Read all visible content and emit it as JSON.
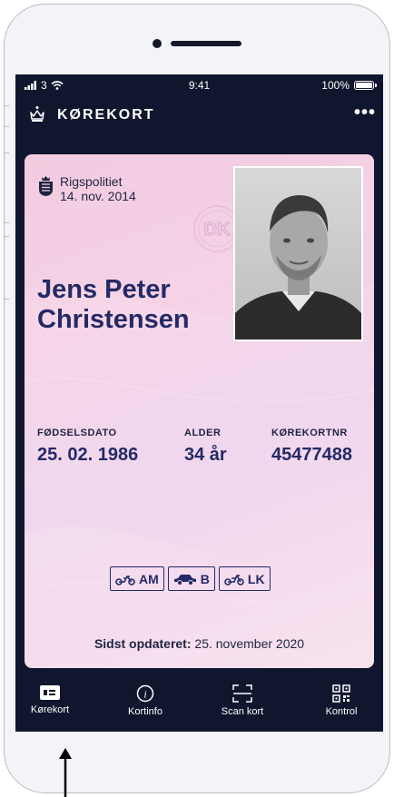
{
  "status_bar": {
    "carrier": "3",
    "time": "9:41",
    "battery": "100%"
  },
  "app_bar": {
    "title": "KØREKORT",
    "menu_glyph": "•••",
    "icons": {
      "logo": "crown-icon",
      "menu": "more-icon"
    }
  },
  "card": {
    "issuer": "Rigspolitiet",
    "issue_date": "14. nov. 2014",
    "holder_name": "Jens Peter Christensen",
    "seal_text": "DK",
    "fields": [
      {
        "label": "FØDSELSDATO",
        "value": "25. 02. 1986"
      },
      {
        "label": "ALDER",
        "value": "34 år"
      },
      {
        "label": "KØREKORTNR",
        "value": "45477488"
      }
    ],
    "categories": [
      {
        "label": "AM",
        "icon": "moped-icon"
      },
      {
        "label": "B",
        "icon": "car-icon"
      },
      {
        "label": "LK",
        "icon": "tractor-icon"
      }
    ],
    "updated_label": "Sidst opdateret:",
    "updated_value": "25. november 2020"
  },
  "tabs": [
    {
      "label": "Kørekort",
      "icon": "license-card-icon",
      "active": true
    },
    {
      "label": "Kortinfo",
      "icon": "info-icon",
      "active": false
    },
    {
      "label": "Scan kort",
      "icon": "scan-icon",
      "active": false
    },
    {
      "label": "Kontrol",
      "icon": "qr-code-icon",
      "active": false
    }
  ],
  "colors": {
    "screen_bg": "#10162d",
    "card_text": "#242a66",
    "card_bg": "#f5d2e6"
  }
}
